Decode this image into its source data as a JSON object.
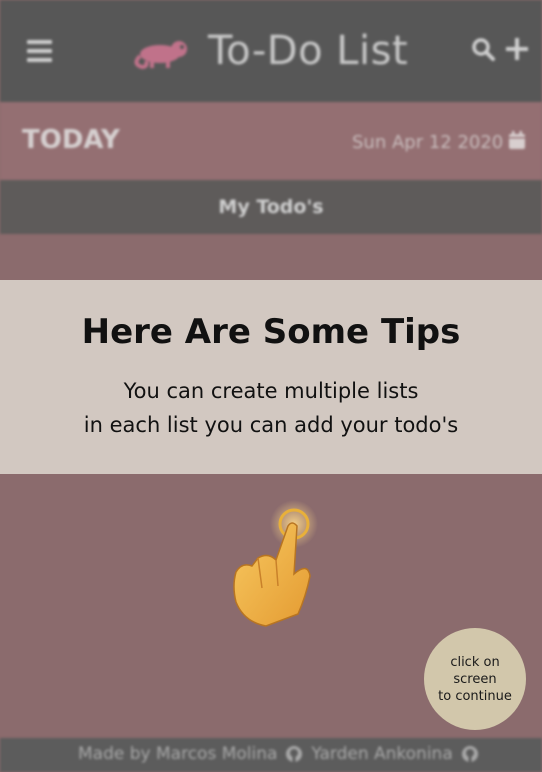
{
  "header": {
    "title": "To-Do List",
    "menu_icon": "hamburger-menu-icon",
    "logo_icon": "chameleon-logo-icon",
    "search_icon": "search-icon",
    "add_icon": "plus-icon"
  },
  "today_bar": {
    "label": "TODAY",
    "date": "Sun Apr 12 2020",
    "calendar_icon": "calendar-icon"
  },
  "list": {
    "title": "My Todo's"
  },
  "footer": {
    "author1": "Made by Marcos Molina",
    "author2": "Yarden Ankonina",
    "github_icon": "github-icon"
  },
  "tips": {
    "title": "Here Are Some Tips",
    "line1": "You can create multiple lists",
    "line2": "in each list you can add your todo's",
    "hand_icon": "pointing-hand-icon"
  },
  "continue": {
    "line1": "click on screen",
    "line2": "to continue"
  },
  "colors": {
    "header_bg": "#575757",
    "today_bg": "#946f72",
    "page_bg": "#8b6b6d",
    "tips_bg": "#d2c8c1",
    "continue_bg": "#d2c7ab",
    "hand": "#f0b44a"
  }
}
